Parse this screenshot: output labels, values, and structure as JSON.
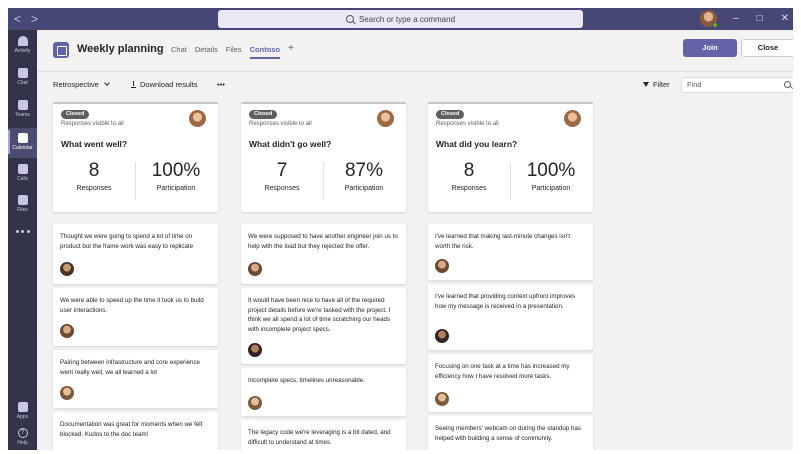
{
  "titlebar": {
    "back": "<",
    "forward": ">",
    "search_placeholder": "Search or type a command",
    "minimize": "–",
    "maximize": "□",
    "close": "✕"
  },
  "appbar": [
    {
      "label": "Activity",
      "icon": "bell-icon"
    },
    {
      "label": "Chat",
      "icon": "chat-icon"
    },
    {
      "label": "Teams",
      "icon": "teams-icon"
    },
    {
      "label": "Calendar",
      "icon": "calendar-icon",
      "active": true
    },
    {
      "label": "Calls",
      "icon": "phone-icon"
    },
    {
      "label": "Files",
      "icon": "file-icon"
    },
    {
      "label": "",
      "icon": "more-icon"
    },
    {
      "label": "Apps",
      "icon": "apps-icon"
    },
    {
      "label": "Help",
      "icon": "help-icon"
    }
  ],
  "header": {
    "title": "Weekly planning",
    "tabs": [
      "Chat",
      "Details",
      "Files",
      "Contoso"
    ],
    "active_tab": "Contoso",
    "plus": "+",
    "join": "Join",
    "close": "Close"
  },
  "toolbar": {
    "retrospective": "Retrospective",
    "download": "Download results",
    "more": "•••",
    "filter": "Filter",
    "find_placeholder": "Find"
  },
  "columns": [
    {
      "status": "Closed",
      "visibility": "Responses visible to all",
      "question": "What went well?",
      "responses": "8",
      "responses_label": "Responses",
      "participation": "100%",
      "participation_label": "Participation",
      "cards": [
        "Thought we were going to spend a lot of time on product but the frame work was easy to replicate",
        "We were able to speed up the time it took us to build user interactions.",
        "Pairing between infrastructure and core experience went really well, we all learned a lot",
        "Documentation was great for moments when we felt blocked. Kudos to the doc team!"
      ]
    },
    {
      "status": "Closed",
      "visibility": "Responses visible to all",
      "question": "What didn't go well?",
      "responses": "7",
      "responses_label": "Responses",
      "participation": "87%",
      "participation_label": "Participation",
      "cards": [
        "We were supposed to have another engineer join us to help with the load but they rejected the offer.",
        "It would have been nice to have all of the required project details before we're tasked with the project. I think we all spend a lot of time scratching our heads with incomplete project specs.",
        "Incomplete specs, timelines unreasonable.",
        "The legacy code we're leveraging is a bit dated, and difficult to understand at times."
      ]
    },
    {
      "status": "Closed",
      "visibility": "Responses visible to all",
      "question": "What did you learn?",
      "responses": "8",
      "responses_label": "Responses",
      "participation": "100%",
      "participation_label": "Participation",
      "cards": [
        "I've learned that making last-minute changes isn't worth the risk.",
        "I've learned that providing context upfront improves how my message is received in a presentation.",
        "Focusing on one task at a time has increased my efficiency how I have resolved more tasks.",
        "Seeing members' webcam on during the standup has helped with building a sense of community."
      ]
    }
  ]
}
